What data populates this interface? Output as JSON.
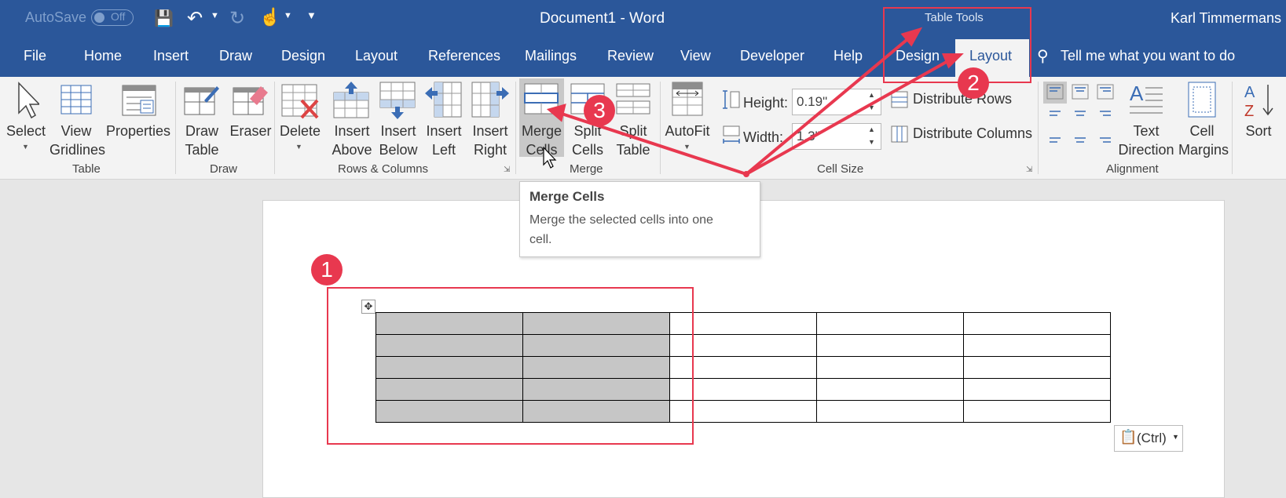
{
  "titlebar": {
    "autosave_label": "AutoSave",
    "autosave_state": "Off",
    "document_title": "Document1  -  Word",
    "context_group": "Table Tools",
    "user_name": "Karl Timmermans"
  },
  "tabs": [
    "File",
    "Home",
    "Insert",
    "Draw",
    "Design",
    "Layout",
    "References",
    "Mailings",
    "Review",
    "View",
    "Developer",
    "Help",
    "Design",
    "Layout"
  ],
  "tell_me": "Tell me what you want to do",
  "ribbon": {
    "table_group": {
      "label": "Table",
      "select": "Select",
      "view_gridlines_1": "View",
      "view_gridlines_2": "Gridlines",
      "properties": "Properties"
    },
    "draw_group": {
      "label": "Draw",
      "draw_table_1": "Draw",
      "draw_table_2": "Table",
      "eraser": "Eraser"
    },
    "rows_columns_group": {
      "label": "Rows & Columns",
      "delete": "Delete",
      "insert_above_1": "Insert",
      "insert_above_2": "Above",
      "insert_below_1": "Insert",
      "insert_below_2": "Below",
      "insert_left_1": "Insert",
      "insert_left_2": "Left",
      "insert_right_1": "Insert",
      "insert_right_2": "Right"
    },
    "merge_group": {
      "label": "Merge",
      "merge_cells_1": "Merge",
      "merge_cells_2": "Cells",
      "split_cells_1": "Split",
      "split_cells_2": "Cells",
      "split_table_1": "Split",
      "split_table_2": "Table"
    },
    "autofit": "AutoFit",
    "cell_size_group": {
      "label": "Cell Size",
      "height_label": "Height:",
      "height_value": "0.19\"",
      "width_label": "Width:",
      "width_value": "1.3\"",
      "distribute_rows": "Distribute Rows",
      "distribute_columns": "Distribute Columns"
    },
    "alignment_group": {
      "label": "Alignment",
      "text_direction_1": "Text",
      "text_direction_2": "Direction",
      "cell_margins_1": "Cell",
      "cell_margins_2": "Margins"
    },
    "sort": "Sort"
  },
  "tooltip": {
    "title": "Merge Cells",
    "line1": "Merge the selected cells into one",
    "line2": "cell."
  },
  "paste_options": "(Ctrl)",
  "callouts": [
    "1",
    "2",
    "3"
  ],
  "colors": {
    "brand": "#2b579a",
    "highlight": "#e8384f",
    "selected_cells": "#c6c6c6"
  }
}
